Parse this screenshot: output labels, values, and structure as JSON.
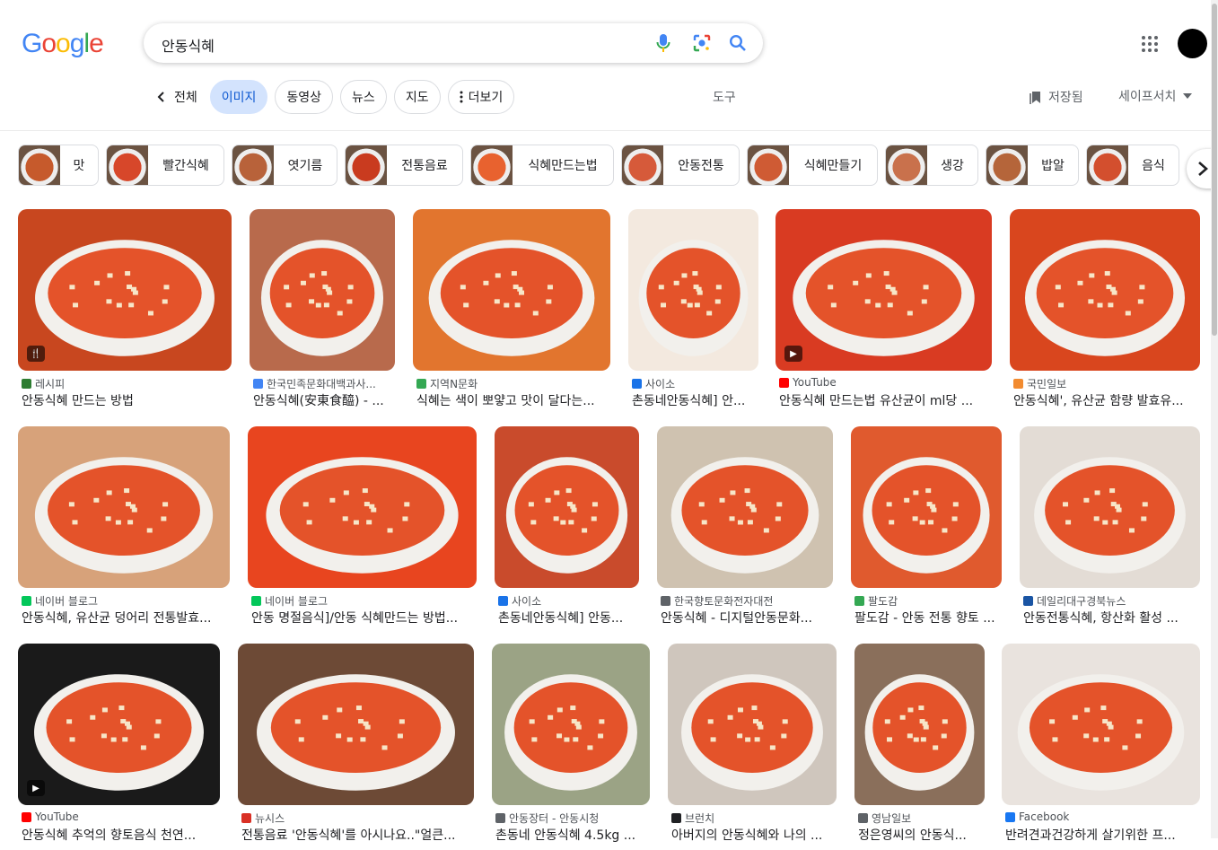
{
  "logo": {
    "letters": [
      "G",
      "o",
      "o",
      "g",
      "l",
      "e"
    ],
    "colors": [
      "#4285F4",
      "#EA4335",
      "#FBBC05",
      "#4285F4",
      "#34A853",
      "#EA4335"
    ]
  },
  "search": {
    "query": "안동식혜"
  },
  "tabs": [
    {
      "label": "전체",
      "active": false,
      "back": true
    },
    {
      "label": "이미지",
      "active": true
    },
    {
      "label": "동영상",
      "active": false
    },
    {
      "label": "뉴스",
      "active": false
    },
    {
      "label": "지도",
      "active": false
    },
    {
      "label": "더보기",
      "active": false,
      "more": true
    }
  ],
  "tools": "도구",
  "saved": "저장됨",
  "safesearch": "세이프서치",
  "chips": [
    {
      "label": "맛",
      "color": "#c65a2c"
    },
    {
      "label": "빨간식혜",
      "color": "#d7472a"
    },
    {
      "label": "엿기름",
      "color": "#b8623a"
    },
    {
      "label": "전통음료",
      "color": "#c93b1f"
    },
    {
      "label": "식혜만드는법",
      "color": "#e8622f"
    },
    {
      "label": "안동전통",
      "color": "#d65a3a"
    },
    {
      "label": "식혜만들기",
      "color": "#cf5b34"
    },
    {
      "label": "생강",
      "color": "#c9714c"
    },
    {
      "label": "밥알",
      "color": "#b5653a"
    },
    {
      "label": "음식",
      "color": "#d34f2e"
    }
  ],
  "results": [
    [
      {
        "source": "레시피",
        "title": "안동식혜 만드는 방법",
        "fav": "#2e7d32",
        "bg": "#c8471f",
        "badge": "recipe"
      },
      {
        "source": "한국민족문화대백과사...",
        "title": "안동식혜(安東食醯) - ...",
        "fav": "#4285F4",
        "bg": "#b86a4c"
      },
      {
        "source": "지역N문화",
        "title": "식혜는 색이 뽀얗고 맛이 달다는...",
        "fav": "#34A853",
        "bg": "#e2752e"
      },
      {
        "source": "사이소",
        "title": "촌동네안동식혜] 안...",
        "fav": "#1a73e8",
        "bg": "#f3e9df"
      },
      {
        "source": "YouTube",
        "title": "안동식혜 만드는법 유산균이 ml당 ...",
        "fav": "#ff0000",
        "bg": "#d93b22",
        "badge": "play"
      },
      {
        "source": "국민일보",
        "title": "안동식혜', 유산균 함량 발효유...",
        "fav": "#f28b30",
        "bg": "#d9461e"
      }
    ],
    [
      {
        "source": "네이버 블로그",
        "title": "안동식혜, 유산균 덩어리 전통발효...",
        "fav": "#03c75a",
        "bg": "#d7a27a"
      },
      {
        "source": "네이버 블로그",
        "title": "안동 명절음식]/안동 식혜만드는 방법...",
        "fav": "#03c75a",
        "bg": "#e8451f"
      },
      {
        "source": "사이소",
        "title": "촌동네안동식혜] 안동...",
        "fav": "#1a73e8",
        "bg": "#c94b2c"
      },
      {
        "source": "한국향토문화전자대전",
        "title": "안동식혜 - 디지털안동문화...",
        "fav": "#5f6368",
        "bg": "#cfc2b0"
      },
      {
        "source": "팔도감",
        "title": "팔도감 - 안동 전통 향토 ...",
        "fav": "#34A853",
        "bg": "#e05a2e"
      },
      {
        "source": "데일리대구경북뉴스",
        "title": "안동전통식혜, 항산화 활성 ...",
        "fav": "#1a55a4",
        "bg": "#e3dcd5"
      }
    ],
    [
      {
        "source": "YouTube",
        "title": "안동식혜 추억의 향토음식 천연...",
        "fav": "#ff0000",
        "bg": "#1a1a1a",
        "badge": "play"
      },
      {
        "source": "뉴시스",
        "title": "전통음료 '안동식혜'를 아시나요..\"얼큰...",
        "fav": "#d93025",
        "bg": "#6d4a36"
      },
      {
        "source": "안동장터 - 안동시청",
        "title": "촌동네 안동식혜 4.5kg ...",
        "fav": "#5f6368",
        "bg": "#9ba385"
      },
      {
        "source": "브런치",
        "title": "아버지의 안동식혜와 나의 ...",
        "fav": "#202124",
        "bg": "#cfc6bd"
      },
      {
        "source": "영남일보",
        "title": "정은영씨의 안동식...",
        "fav": "#5f6368",
        "bg": "#8a6f5b"
      },
      {
        "source": "Facebook",
        "title": "반려견과건강하게 살기위한 프...",
        "fav": "#1877f2",
        "bg": "#e9e3de"
      }
    ]
  ]
}
